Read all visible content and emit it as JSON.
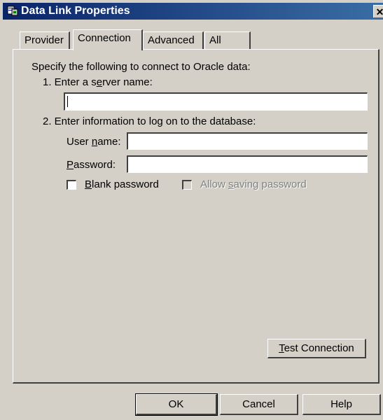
{
  "window": {
    "title": "Data Link Properties",
    "close_glyph": "✕"
  },
  "tabs": [
    {
      "label": "Provider",
      "active": false
    },
    {
      "label": "Connection",
      "active": true
    },
    {
      "label": "Advanced",
      "active": false
    },
    {
      "label": "All",
      "active": false
    }
  ],
  "connection": {
    "intro": "Specify the following to connect to Oracle data:",
    "step1_prefix": "1. Enter a s",
    "step1_mnemonic": "e",
    "step1_suffix": "rver name:",
    "server_name_value": "",
    "step2": "2. Enter information to log on to the database:",
    "user_prefix": "User ",
    "user_mnemonic": "n",
    "user_suffix": "ame:",
    "user_value": "",
    "password_mnemonic": "P",
    "password_suffix": "assword:",
    "password_value": "",
    "blank_mnemonic": "B",
    "blank_suffix": "lank password",
    "blank_checked": false,
    "allow_prefix": "Allow ",
    "allow_mnemonic": "s",
    "allow_suffix": "aving password",
    "allow_checked": false,
    "allow_enabled": false,
    "test_mnemonic": "T",
    "test_suffix": "est Connection"
  },
  "footer": {
    "ok": "OK",
    "cancel": "Cancel",
    "help": "Help"
  }
}
